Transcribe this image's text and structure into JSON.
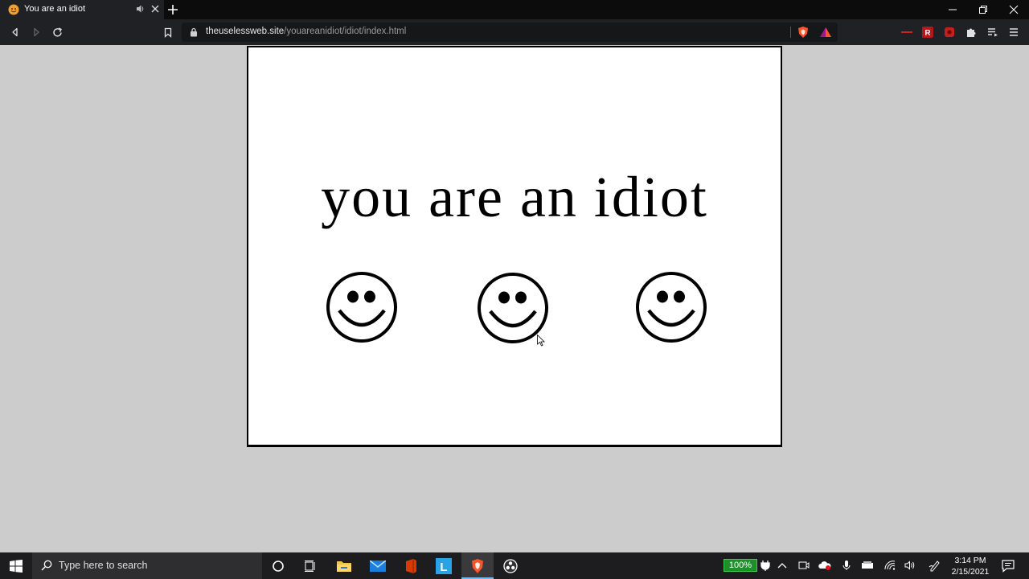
{
  "browser": {
    "tab_title": "You are an idiot",
    "url_host": "theuselessweb.site",
    "url_path": "/youareanidiot/idiot/index.html"
  },
  "page": {
    "headline": "you are an idiot"
  },
  "taskbar": {
    "search_placeholder": "Type here to search",
    "battery": "100%",
    "time": "3:14 PM",
    "date": "2/15/2021"
  },
  "icons": {
    "tab": [
      "brave-favicon-icon",
      "speaker-icon",
      "close-icon",
      "plus-icon"
    ],
    "toolbar": [
      "back-icon",
      "forward-icon",
      "reload-icon",
      "bookmark-icon",
      "lock-icon",
      "brave-shield-icon",
      "brave-rewards-icon",
      "extensions-icon",
      "playlist-icon",
      "menu-icon"
    ],
    "page": [
      "smiley-icon",
      "smiley-icon",
      "smiley-icon",
      "cursor-icon"
    ]
  },
  "colors": {
    "chrome_bg": "#202124",
    "page_bg": "#cccccc",
    "battery_green": "#1f8f2b",
    "brave_orange": "#fb542b"
  }
}
